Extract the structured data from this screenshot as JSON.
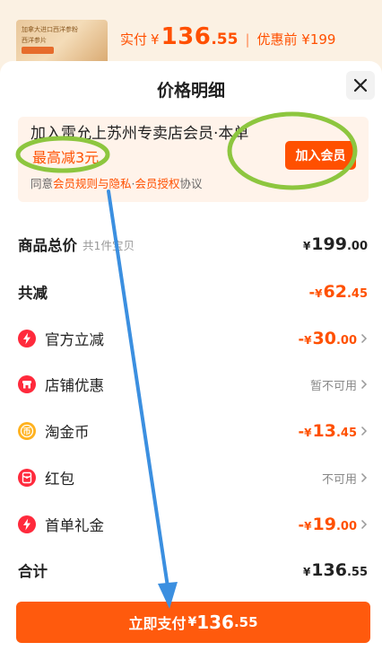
{
  "product_peek": {
    "thumb_line1": "加拿大进口西洋参粉",
    "thumb_line2": "西洋参片",
    "price_label": "实付",
    "currency": "¥",
    "price_int": "136",
    "price_dec": ".55",
    "separator": "|",
    "before_price": "优惠前 ¥199"
  },
  "sheet": {
    "title": "价格明细",
    "close_icon": "close-icon"
  },
  "promo": {
    "title": "加入雷允上苏州专卖店会员·本单",
    "max_discount": "最高减3元",
    "agree_prefix": "同意",
    "agree_link1": "会员规则与隐私",
    "agree_mid": "·",
    "agree_link2": "会员授权",
    "agree_suffix": "协议",
    "join_button": "加入会员"
  },
  "rows": {
    "total": {
      "label": "商品总价",
      "sub": "共1件宝贝",
      "y": "¥",
      "i": "199",
      "d": ".00"
    },
    "discount": {
      "label": "共减",
      "neg": "-",
      "y": "¥",
      "i": "62",
      "d": ".45"
    },
    "official": {
      "label": "官方立减",
      "neg": "-",
      "y": "¥",
      "i": "30",
      "d": ".00",
      "icon": "bolt-icon"
    },
    "shop": {
      "label": "店铺优惠",
      "status": "暂不可用",
      "icon": "shop-icon"
    },
    "coins": {
      "label": "淘金币",
      "neg": "-",
      "y": "¥",
      "i": "13",
      "d": ".45",
      "icon": "coin-icon"
    },
    "redpacket": {
      "label": "红包",
      "status": "不可用",
      "icon": "red-packet-icon"
    },
    "firstorder": {
      "label": "首单礼金",
      "neg": "-",
      "y": "¥",
      "i": "19",
      "d": ".00",
      "icon": "bolt-icon"
    },
    "sum": {
      "label": "合计",
      "y": "¥",
      "i": "136",
      "d": ".55"
    }
  },
  "pay_button": {
    "label": "立即支付",
    "y": "¥",
    "i": "136",
    "d": ".55"
  },
  "colors": {
    "accent": "#ff5000",
    "annotation_green": "#8dc63f",
    "annotation_blue": "#3b8fe0"
  }
}
